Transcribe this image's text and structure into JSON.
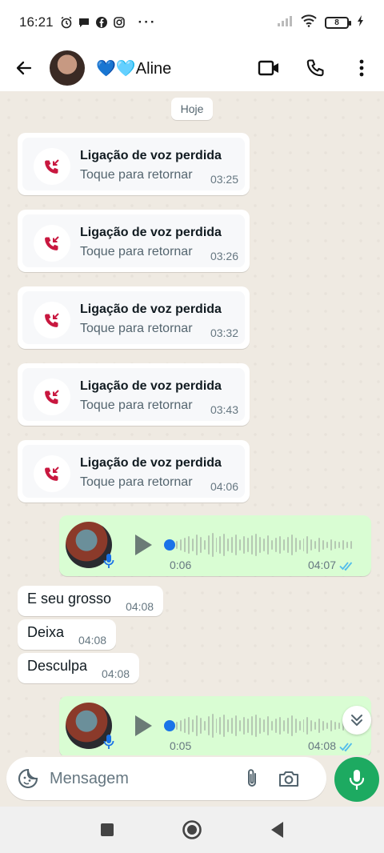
{
  "status_bar": {
    "time": "16:21",
    "battery": "8",
    "more": "···"
  },
  "header": {
    "contact_name": "💙🩵Aline"
  },
  "chat": {
    "date_label": "Hoje",
    "missed_calls": [
      {
        "title": "Ligação de voz perdida",
        "subtitle": "Toque para retornar",
        "time": "03:25"
      },
      {
        "title": "Ligação de voz perdida",
        "subtitle": "Toque para retornar",
        "time": "03:26"
      },
      {
        "title": "Ligação de voz perdida",
        "subtitle": "Toque para retornar",
        "time": "03:32"
      },
      {
        "title": "Ligação de voz perdida",
        "subtitle": "Toque para retornar",
        "time": "03:43"
      },
      {
        "title": "Ligação de voz perdida",
        "subtitle": "Toque para retornar",
        "time": "04:06"
      }
    ],
    "voice_messages": [
      {
        "duration": "0:06",
        "time": "04:07"
      },
      {
        "duration": "0:05",
        "time": "04:08"
      }
    ],
    "text_messages": [
      {
        "text": "E seu grosso",
        "time": "04:08"
      },
      {
        "text": "Deixa",
        "time": "04:08"
      },
      {
        "text": "Desculpa",
        "time": "04:08"
      }
    ]
  },
  "input": {
    "placeholder": "Mensagem"
  },
  "colors": {
    "chat_background": "#efeae2",
    "outgoing_bubble": "#d9fdd3",
    "mic_button": "#1daa61",
    "missed_call_icon": "#c8173f",
    "read_ticks": "#53bdeb"
  }
}
